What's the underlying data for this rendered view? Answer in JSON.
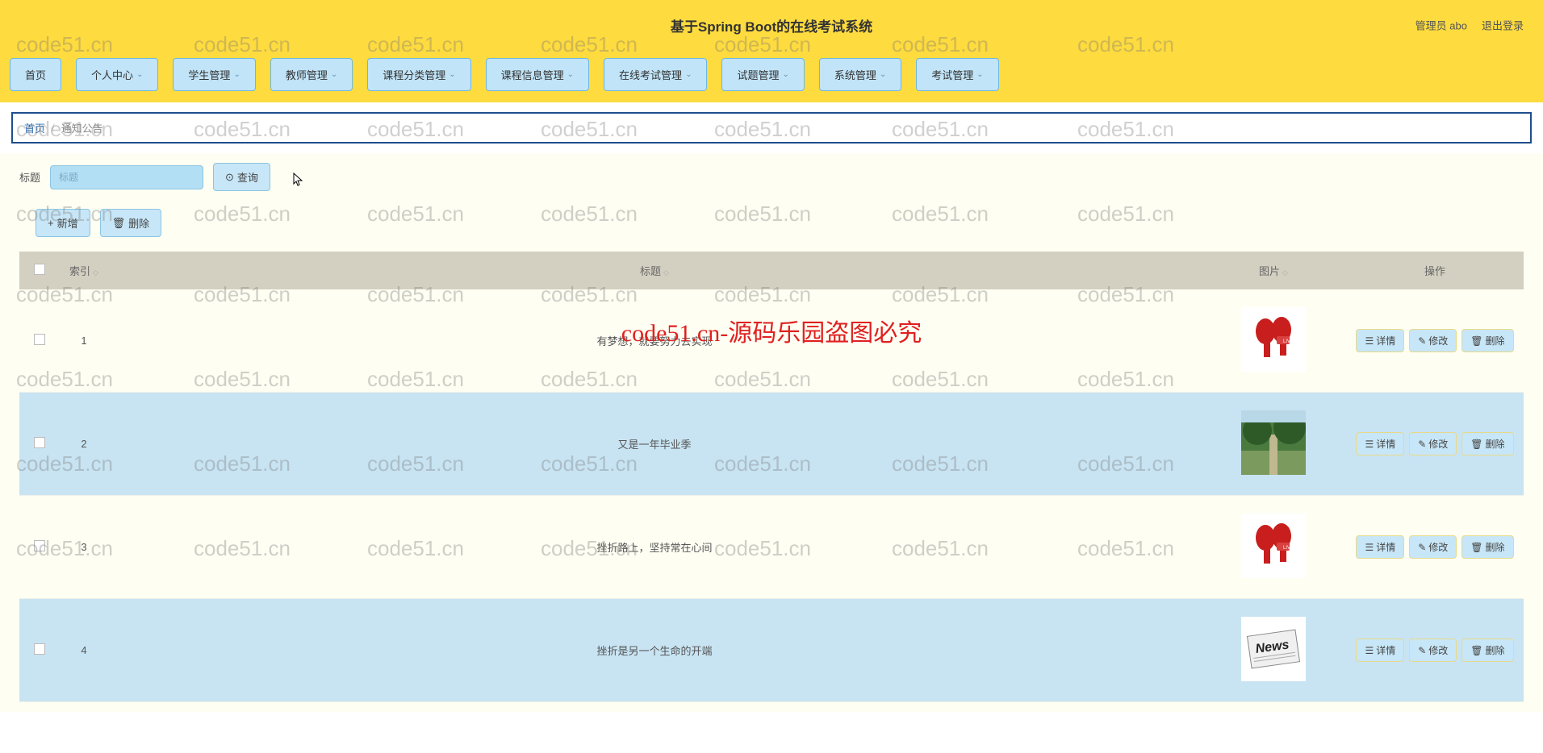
{
  "header": {
    "title": "基于Spring Boot的在线考试系统",
    "admin_label": "管理员 abo",
    "logout_label": "退出登录"
  },
  "nav": [
    {
      "label": "首页",
      "has_sub": false
    },
    {
      "label": "个人中心",
      "has_sub": true
    },
    {
      "label": "学生管理",
      "has_sub": true
    },
    {
      "label": "教师管理",
      "has_sub": true
    },
    {
      "label": "课程分类管理",
      "has_sub": true
    },
    {
      "label": "课程信息管理",
      "has_sub": true
    },
    {
      "label": "在线考试管理",
      "has_sub": true
    },
    {
      "label": "试题管理",
      "has_sub": true
    },
    {
      "label": "系统管理",
      "has_sub": true
    },
    {
      "label": "考试管理",
      "has_sub": true
    }
  ],
  "breadcrumb": {
    "home": "首页",
    "current": "通知公告"
  },
  "filter": {
    "label": "标题",
    "placeholder": "标题",
    "search_btn": "查询"
  },
  "toolbar": {
    "add": "新增",
    "delete": "删除"
  },
  "table": {
    "headers": {
      "index": "索引",
      "title": "标题",
      "image": "图片",
      "action": "操作"
    },
    "rows": [
      {
        "index": "1",
        "title": "有梦想，就要努力去实现",
        "image": "mic"
      },
      {
        "index": "2",
        "title": "又是一年毕业季",
        "image": "campus"
      },
      {
        "index": "3",
        "title": "挫折路上，坚持常在心间",
        "image": "mic"
      },
      {
        "index": "4",
        "title": "挫折是另一个生命的开端",
        "image": "news"
      }
    ],
    "actions": {
      "detail": "详情",
      "edit": "修改",
      "delete": "删除"
    }
  },
  "watermark": {
    "text": "code51.cn",
    "center": "code51.cn-源码乐园盗图必究"
  }
}
